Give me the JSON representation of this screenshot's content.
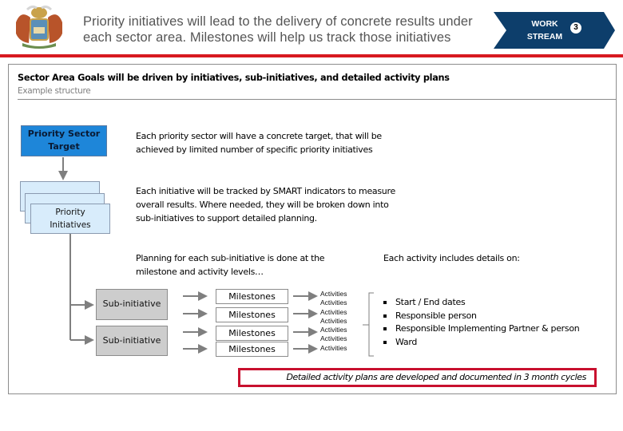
{
  "header": {
    "logo": "coat-of-arms-emblem",
    "title_line1": "Priority initiatives will lead to the delivery of concrete results under",
    "title_line2": "each sector area.  Milestones will help us track those initiatives",
    "workstream": {
      "line1": "WORK",
      "line2": "STREAM",
      "number": "3"
    },
    "colors": {
      "workstream_bg": "#0d3e6b",
      "accent_line": "#d71920"
    }
  },
  "section": {
    "heading": "Sector Area Goals will be driven by initiatives, sub-initiatives, and detailed activity plans",
    "subheading": "Example structure"
  },
  "diagram": {
    "target_box": {
      "line1": "Priority Sector",
      "line2": "Target",
      "color": "#1e86d9"
    },
    "initiatives_box": {
      "line1": "Priority",
      "line2": "Initiatives",
      "color": "#d8ecfb"
    },
    "sub_initiatives": [
      "Sub-initiative",
      "Sub-initiative"
    ],
    "milestones": [
      "Milestones",
      "Milestones",
      "Milestones",
      "Milestones"
    ],
    "activities": [
      "Activities",
      "Activities",
      "Activities",
      "Activities",
      "Activities",
      "Activities",
      "Activities"
    ]
  },
  "descriptions": {
    "target_line1": "Each priority sector will have a concrete target, that will be",
    "target_line2": "achieved by limited number of specific priority initiatives",
    "initiative_line1": "Each initiative will be tracked by SMART indicators to measure",
    "initiative_line2": "overall results.   Where needed, they will be broken down into",
    "initiative_line3": "sub-initiatives to support detailed planning.",
    "planning_line1": "Planning for each sub-initiative is done at the",
    "planning_line2": "milestone and activity levels…",
    "activity_heading": "Each activity includes details on:"
  },
  "activity_details": [
    "Start / End dates",
    "Responsible person",
    "Responsible Implementing Partner & person",
    "Ward"
  ],
  "callout": {
    "text": "Detailed activity plans are developed and documented in 3 month cycles",
    "border_color": "#c8102e"
  }
}
